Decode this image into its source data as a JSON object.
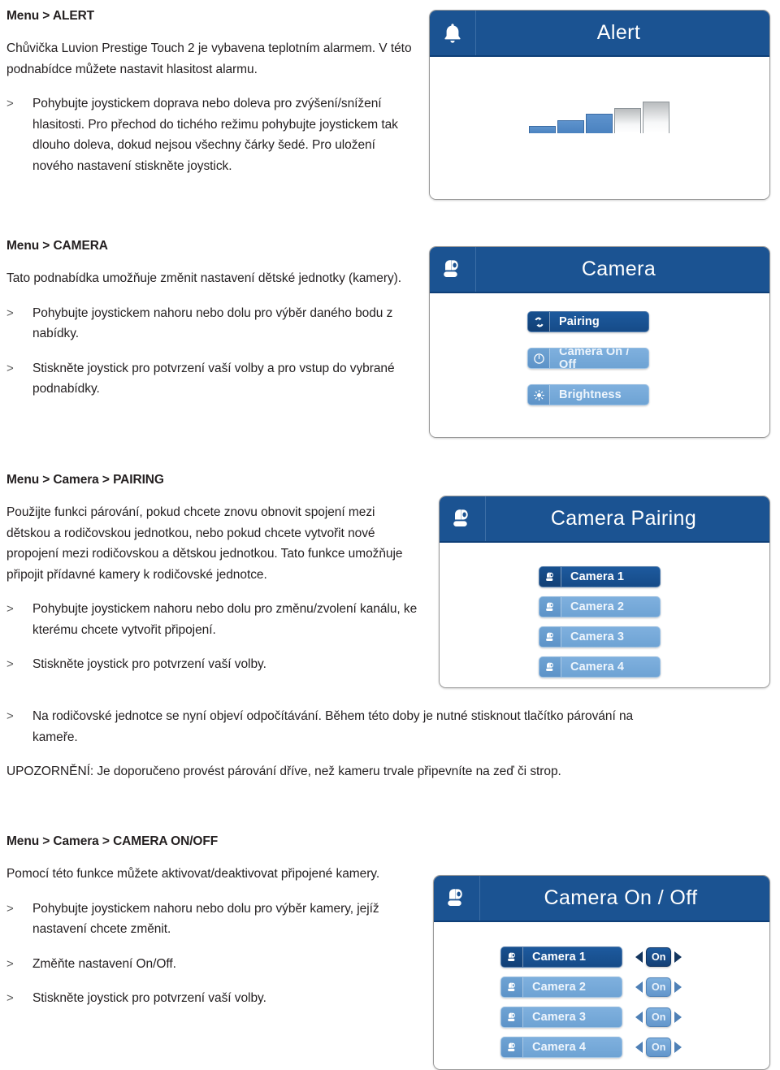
{
  "sections": [
    {
      "id": "alert",
      "heading": {
        "prefix": "Menu",
        "sep": ">",
        "name": "ALERT"
      },
      "paragraph": "Chůvička Luvion Prestige Touch 2 je vybavena teplotním alarmem. V této podnabídce můžete nastavit hlasitost alarmu.",
      "bullets": [
        {
          "mark": ">",
          "text": "Pohybujte joystickem doprava nebo doleva pro zvýšení/snížení hlasitosti. Pro přechod do tichého režimu pohybujte joystickem tak dlouho doleva, dokud nejsou všechny čárky šedé. Pro uložení nového nastavení stiskněte joystick."
        }
      ]
    },
    {
      "id": "camera",
      "heading": {
        "prefix": "Menu",
        "sep": ">",
        "name": "CAMERA"
      },
      "paragraph": "Tato podnabídka umožňuje změnit nastavení dětské jednotky (kamery).",
      "bullets": [
        {
          "mark": ">",
          "text": "Pohybujte joystickem nahoru nebo dolu pro výběr daného bodu z nabídky."
        },
        {
          "mark": ">",
          "text": "Stiskněte joystick pro potvrzení vaší volby a pro vstup do vybrané podnabídky."
        }
      ]
    },
    {
      "id": "pairing",
      "heading": {
        "prefix": "Menu > Camera",
        "sep": ">",
        "name": "PAIRING"
      },
      "paragraph": "Použijte funkci párování, pokud chcete znovu obnovit spojení mezi dětskou a rodičovskou jednotkou, nebo pokud chcete vytvořit nové propojení mezi rodičovskou a dětskou jednotkou. Tato funkce umožňuje připojit přídavné kamery k rodičovské jednotce.",
      "bullets": [
        {
          "mark": ">",
          "text": "Pohybujte joystickem nahoru nebo dolu pro změnu/zvolení kanálu, ke kterému chcete vytvořit připojení."
        },
        {
          "mark": ">",
          "text": "Stiskněte joystick pro potvrzení vaší volby."
        },
        {
          "mark": ">",
          "text": "Na rodičovské jednotce se nyní objeví odpočítávání. Během této doby je nutné stisknout tlačítko párování na kameře."
        }
      ],
      "notice": "UPOZORNĚNÍ: Je doporučeno provést párování dříve, než kameru trvale připevníte na zeď či strop."
    },
    {
      "id": "camera-onoff",
      "heading": {
        "prefix": "Menu > Camera",
        "sep": ">",
        "name": "CAMERA ON/OFF"
      },
      "paragraph": "Pomocí této funkce můžete aktivovat/deaktivovat připojené kamery.",
      "bullets": [
        {
          "mark": ">",
          "text": "Pohybujte joystickem nahoru nebo dolu pro výběr kamery, jejíž nastavení chcete změnit."
        },
        {
          "mark": ">",
          "text": "Změňte nastavení On/Off."
        },
        {
          "mark": ">",
          "text": "Stiskněte joystick pro potvrzení vaší volby."
        }
      ]
    }
  ],
  "panels": {
    "alert": {
      "title": "Alert",
      "icon": "bell-icon",
      "volume": {
        "total": 5,
        "filled": 3
      }
    },
    "camera": {
      "title": "Camera",
      "icon": "camera-icon",
      "items": [
        {
          "label": "Pairing",
          "icon": "sync-icon",
          "selected": true
        },
        {
          "label": "Camera On / Off",
          "icon": "power-icon",
          "selected": false
        },
        {
          "label": "Brightness",
          "icon": "brightness-icon",
          "selected": false
        }
      ]
    },
    "camera_pairing": {
      "title": "Camera Pairing",
      "icon": "camera-icon",
      "items": [
        {
          "label": "Camera 1",
          "icon": "camera-icon",
          "selected": true
        },
        {
          "label": "Camera 2",
          "icon": "camera-icon",
          "selected": false
        },
        {
          "label": "Camera 3",
          "icon": "camera-icon",
          "selected": false
        },
        {
          "label": "Camera 4",
          "icon": "camera-icon",
          "selected": false
        }
      ]
    },
    "camera_onoff": {
      "title": "Camera On / Off",
      "icon": "camera-icon",
      "items": [
        {
          "label": "Camera 1",
          "icon": "camera-icon",
          "selected": true,
          "state": "On"
        },
        {
          "label": "Camera 2",
          "icon": "camera-icon",
          "selected": false,
          "state": "On"
        },
        {
          "label": "Camera 3",
          "icon": "camera-icon",
          "selected": false,
          "state": "On"
        },
        {
          "label": "Camera 4",
          "icon": "camera-icon",
          "selected": false,
          "state": "On"
        }
      ]
    }
  },
  "colors": {
    "header_blue": "#1b5392",
    "selected_blue": "#164b88",
    "idle_blue": "#7fb0de",
    "meter_blue": "#4a82c0",
    "text": "#231f20"
  }
}
